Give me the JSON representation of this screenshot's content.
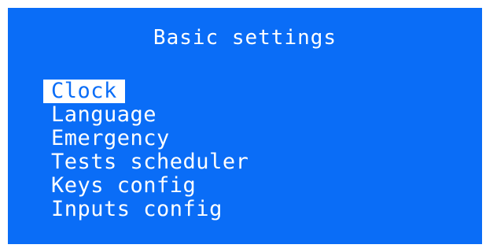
{
  "screen": {
    "title": "Basic settings",
    "background_color": "#0a6df7",
    "text_color": "#ffffff"
  },
  "menu": {
    "selected_index": 0,
    "items": [
      {
        "label": "Clock"
      },
      {
        "label": "Language"
      },
      {
        "label": "Emergency"
      },
      {
        "label": "Tests scheduler"
      },
      {
        "label": "Keys config"
      },
      {
        "label": "Inputs config"
      }
    ]
  }
}
